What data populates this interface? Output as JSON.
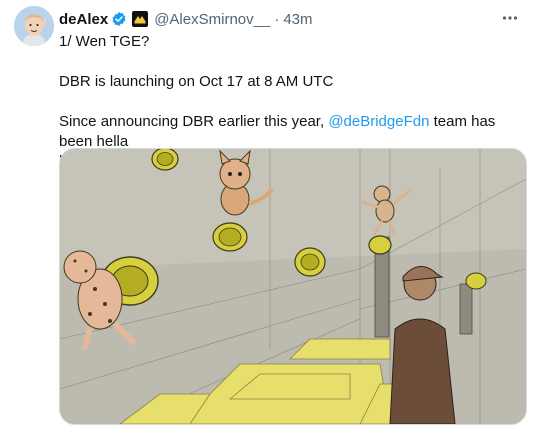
{
  "author": {
    "display_name": "deAlex",
    "handle": "@AlexSmirnov__",
    "separator": "·",
    "time": "43m"
  },
  "tweet": {
    "line1": "1/ Wen TGE?",
    "line2": "DBR is launching on Oct 17 at 8 AM UTC",
    "line3_before": "Since announcing DBR earlier this year, ",
    "line3_mention": "@deBridgeFdn",
    "line3_after": " team has been hella",
    "line4": "busy"
  },
  "icons": {
    "verified": "verified-badge-icon",
    "affiliate": "affiliate-logo-icon",
    "more": "more-options-icon",
    "emoji": "pointing-down-emoji-icon"
  },
  "colors": {
    "text": "#0f1419",
    "secondary": "#536471",
    "link": "#1d9bf0",
    "verified": "#1d9bf0"
  }
}
